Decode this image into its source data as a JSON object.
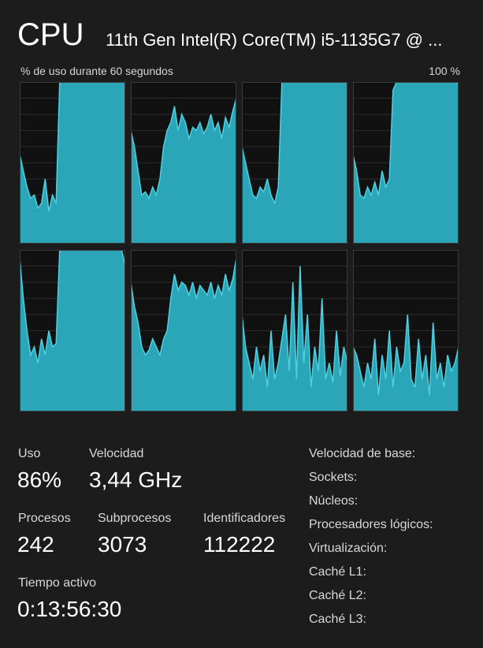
{
  "header": {
    "title": "CPU",
    "subtitle": "11th Gen Intel(R) Core(TM) i5-1135G7 @ ..."
  },
  "graph": {
    "caption_left": "% de uso durante 60 segundos",
    "caption_right": "100 %",
    "fill_color": "#2aa6b8",
    "line_color": "#4fd0e0"
  },
  "stats": {
    "uso_label": "Uso",
    "uso_value": "86%",
    "velocidad_label": "Velocidad",
    "velocidad_value": "3,44 GHz",
    "procesos_label": "Procesos",
    "procesos_value": "242",
    "subprocesos_label": "Subprocesos",
    "subprocesos_value": "3073",
    "identificadores_label": "Identificadores",
    "identificadores_value": "112222",
    "tiempo_label": "Tiempo activo",
    "tiempo_value": "0:13:56:30"
  },
  "info": {
    "base_speed": "Velocidad de base:",
    "sockets": "Sockets:",
    "cores": "Núcleos:",
    "logical": "Procesadores lógicos:",
    "virtualization": "Virtualización:",
    "l1": "Caché L1:",
    "l2": "Caché L2:",
    "l3": "Caché L3:"
  },
  "chart_data": {
    "type": "area",
    "ylim": [
      0,
      100
    ],
    "series": [
      {
        "values": [
          55,
          45,
          35,
          28,
          30,
          22,
          25,
          40,
          20,
          30,
          25,
          100,
          100,
          100,
          100,
          100,
          100,
          100,
          100,
          100,
          100,
          100,
          100,
          100,
          100,
          100,
          100,
          100,
          100,
          100
        ]
      },
      {
        "values": [
          70,
          60,
          45,
          30,
          32,
          28,
          35,
          30,
          40,
          60,
          70,
          75,
          85,
          70,
          80,
          75,
          65,
          72,
          70,
          75,
          68,
          72,
          80,
          70,
          75,
          65,
          78,
          72,
          82,
          90
        ]
      },
      {
        "values": [
          60,
          50,
          40,
          30,
          28,
          35,
          32,
          40,
          30,
          25,
          35,
          100,
          100,
          100,
          100,
          100,
          100,
          100,
          100,
          100,
          100,
          100,
          100,
          100,
          100,
          100,
          100,
          100,
          100,
          100
        ]
      },
      {
        "values": [
          55,
          45,
          30,
          28,
          35,
          30,
          38,
          30,
          45,
          35,
          40,
          95,
          100,
          100,
          100,
          100,
          100,
          100,
          100,
          100,
          100,
          100,
          100,
          100,
          100,
          100,
          100,
          100,
          100,
          99
        ]
      },
      {
        "values": [
          95,
          70,
          50,
          35,
          40,
          30,
          45,
          35,
          50,
          40,
          42,
          100,
          100,
          100,
          100,
          100,
          100,
          100,
          100,
          100,
          100,
          100,
          100,
          100,
          100,
          100,
          100,
          100,
          100,
          90
        ]
      },
      {
        "values": [
          80,
          65,
          55,
          40,
          35,
          38,
          45,
          40,
          35,
          45,
          50,
          70,
          85,
          75,
          80,
          78,
          72,
          80,
          70,
          78,
          75,
          72,
          80,
          70,
          78,
          72,
          85,
          75,
          82,
          95
        ]
      },
      {
        "values": [
          60,
          40,
          30,
          20,
          40,
          25,
          35,
          15,
          50,
          20,
          30,
          45,
          60,
          25,
          80,
          20,
          90,
          30,
          60,
          15,
          40,
          25,
          70,
          20,
          30,
          18,
          50,
          22,
          40,
          30
        ]
      },
      {
        "values": [
          40,
          35,
          25,
          15,
          30,
          20,
          45,
          10,
          35,
          20,
          50,
          15,
          40,
          25,
          30,
          60,
          20,
          15,
          45,
          20,
          35,
          10,
          55,
          20,
          30,
          15,
          35,
          25,
          30,
          40
        ]
      }
    ]
  }
}
